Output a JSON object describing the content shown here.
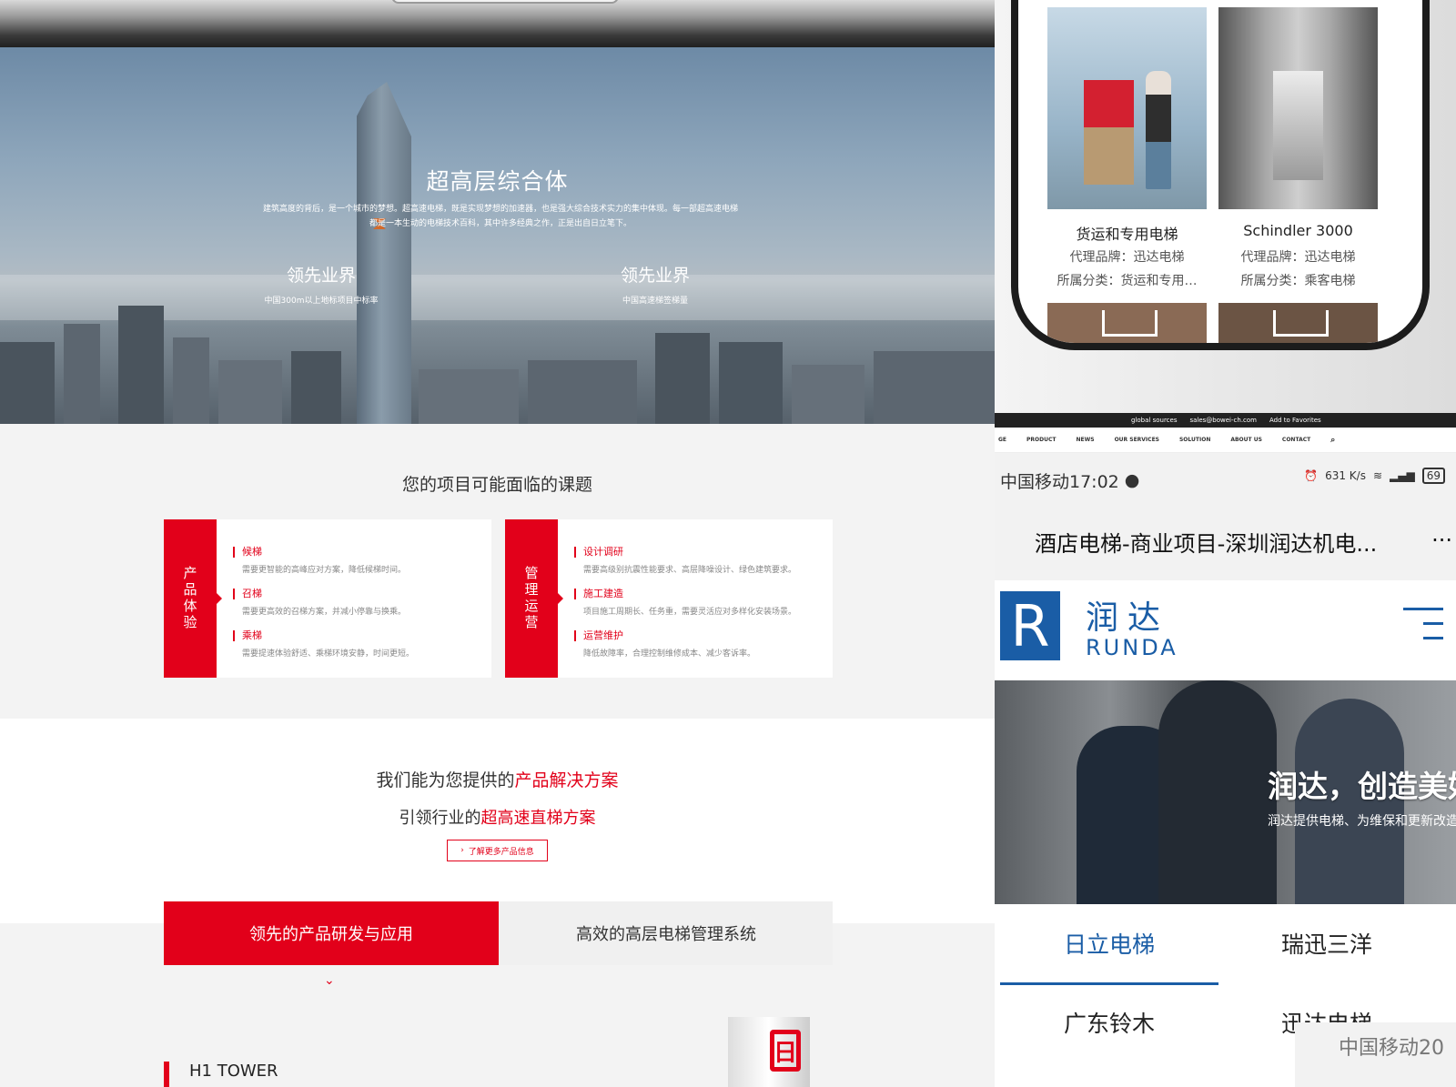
{
  "left": {
    "hero": {
      "title": "超高层综合体",
      "desc": "建筑高度的背后，是一个城市的梦想。超高速电梯，既是实现梦想的加速器，也是强大综合技术实力的集中体现。每一部超高速电梯都是一本生动的电梯技术百科，其中许多经典之作，正是出自日立笔下。",
      "stats": [
        {
          "title": "领先业界",
          "sub": "中国300m以上地标项目中标率"
        },
        {
          "title": "领先业界",
          "sub": "中国高速梯签梯量"
        }
      ]
    },
    "challenges": {
      "title": "您的项目可能面临的课题",
      "cards": [
        {
          "tag": "产品体验",
          "items": [
            {
              "h": "候梯",
              "d": "需要更智能的高峰应对方案，降低候梯时间。"
            },
            {
              "h": "召梯",
              "d": "需要更高效的召梯方案，并减小停靠与换乘。"
            },
            {
              "h": "乘梯",
              "d": "需要提速体验舒适、乘梯环境安静，时间更短。"
            }
          ]
        },
        {
          "tag": "管理运营",
          "items": [
            {
              "h": "设计调研",
              "d": "需要高级别抗震性能要求、高层降噪设计、绿色建筑要求。"
            },
            {
              "h": "施工建造",
              "d": "项目施工周期长、任务重，需要灵活应对多样化安装场景。"
            },
            {
              "h": "运营维护",
              "d": "降低故障率，合理控制维修成本、减少客诉率。"
            }
          ]
        }
      ]
    },
    "solutions": {
      "line1_pre": "我们能为您提供的",
      "line1_hl": "产品解决方案",
      "line2_pre": "引领行业的",
      "line2_hl": "超高速直梯方案",
      "more_label": "了解更多产品信息"
    },
    "tabs": [
      "领先的产品研发与应用",
      "高效的高层电梯管理系统"
    ],
    "product_title": "H1 TOWER",
    "product_mark": "日"
  },
  "rtop": {
    "products": [
      {
        "name": "货运和专用电梯",
        "brand": "代理品牌：迅达电梯",
        "category": "所属分类：货运和专用…"
      },
      {
        "name": "Schindler 3000",
        "brand": "代理品牌：迅达电梯",
        "category": "所属分类：乘客电梯"
      }
    ]
  },
  "rbot": {
    "strip1": [
      "global sources",
      "sales@bowei-ch.com",
      "Add to Favorites"
    ],
    "nav": [
      "GE",
      "PRODUCT",
      "NEWS",
      "OUR SERVICES",
      "SOLUTION",
      "ABOUT US",
      "CONTACT"
    ],
    "status": {
      "carrier_time": "中国移动17:02",
      "speed": "631 K/s",
      "battery": "69"
    },
    "page_title": "酒店电梯-商业项目-深圳润达机电...",
    "more_icon": "···",
    "brand": {
      "letter": "R",
      "cn": "润达",
      "en": "RUNDA"
    },
    "banner": {
      "headline": "润达，创造美好",
      "sub": "润达提供电梯、为维保和更新改造"
    },
    "tabs": [
      "日立电梯",
      "瑞迅三洋",
      "广东铃木",
      "迅达电梯"
    ],
    "watermark": "中国移动20"
  },
  "colors": {
    "accent_red": "#e2001a",
    "brand_blue": "#1a5da6"
  }
}
